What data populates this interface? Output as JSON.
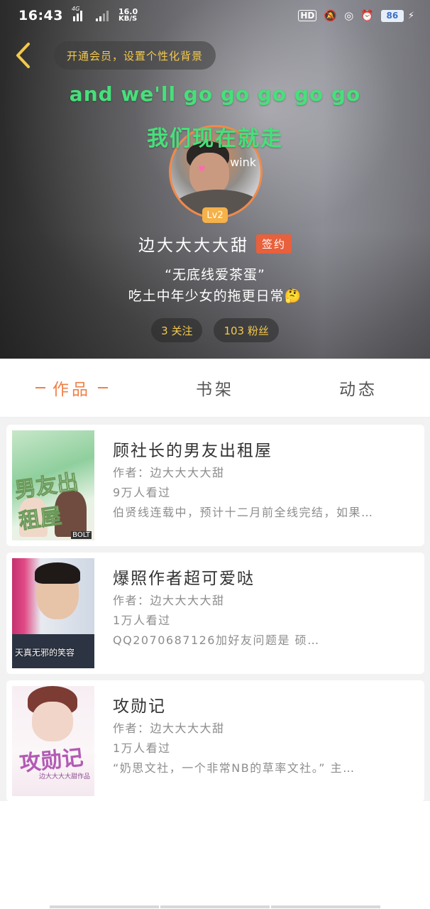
{
  "status_bar": {
    "time": "16:43",
    "network": "4G",
    "speed_value": "16.0",
    "speed_unit": "KB/S",
    "hd": "HD",
    "battery": "86"
  },
  "header": {
    "vip_prompt": "开通会员，设置个性化背景",
    "danmaku_en": "and we'll go go go go go",
    "danmaku_cn": "我们现在就走",
    "avatar_overlay_text": "wink",
    "level": "Lv2",
    "username": "边大大大大甜",
    "signed_badge": "签约",
    "bio_line1": "“无底线爱茶蛋”",
    "bio_line2": "吃土中年少女的拖更日常🤔",
    "following": "3 关注",
    "followers": "103 粉丝"
  },
  "tabs": [
    {
      "label": "作品",
      "active": true
    },
    {
      "label": "书架",
      "active": false
    },
    {
      "label": "动态",
      "active": false
    }
  ],
  "works": [
    {
      "title": "顾社长的男友出租屋",
      "author": "作者：边大大大大甜",
      "views": "9万人看过",
      "desc": "伯贤线连载中，预计十二月前全线完结，如果…",
      "cover_text": "男友出租屋",
      "cover_tag": "BOLT"
    },
    {
      "title": "爆照作者超可爱哒",
      "author": "作者：边大大大大甜",
      "views": "1万人看过",
      "desc": "QQ2070687126加好友问题是 硕…",
      "cover_text": "天真无邪的笑容"
    },
    {
      "title": "攻勋记",
      "author": "作者：边大大大大甜",
      "views": "1万人看过",
      "desc": "“奶思文社，一个非常NB的草率文社。” 主…",
      "cover_text": "攻勋记",
      "cover_sub": "边大大大大甜作品"
    }
  ],
  "colors": {
    "accent": "#ef8048",
    "gold": "#f4c94a",
    "danmaku": "#46e07a",
    "signed": "#e8603c"
  }
}
